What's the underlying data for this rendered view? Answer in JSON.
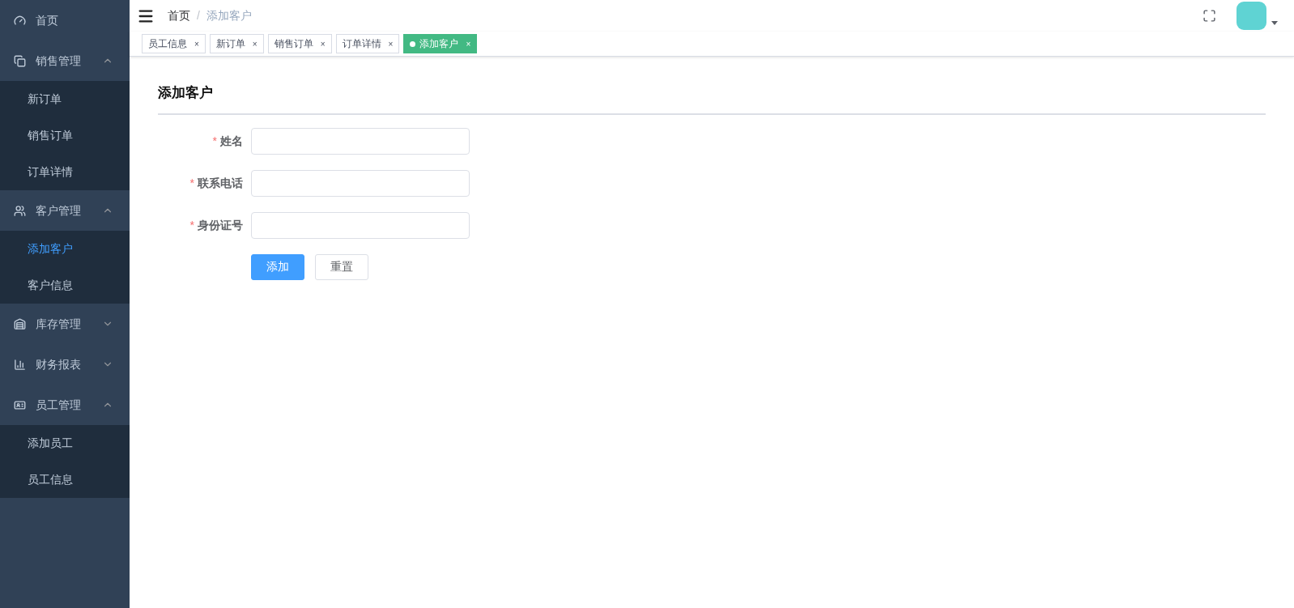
{
  "sidebar": {
    "menu": [
      {
        "label": "首页"
      },
      {
        "label": "销售管理",
        "expanded": true,
        "children": [
          {
            "label": "新订单",
            "selected": false
          },
          {
            "label": "销售订单",
            "selected": false
          },
          {
            "label": "订单详情",
            "selected": false
          }
        ]
      },
      {
        "label": "客户管理",
        "expanded": true,
        "children": [
          {
            "label": "添加客户",
            "selected": true
          },
          {
            "label": "客户信息",
            "selected": false
          }
        ]
      },
      {
        "label": "库存管理",
        "expanded": false
      },
      {
        "label": "财务报表",
        "expanded": false
      },
      {
        "label": "员工管理",
        "expanded": true,
        "children": [
          {
            "label": "添加员工",
            "selected": false
          },
          {
            "label": "员工信息",
            "selected": false
          }
        ]
      }
    ]
  },
  "breadcrumb": [
    "首页",
    "添加客户"
  ],
  "breadcrumb_separator": "/",
  "tabs": [
    {
      "label": "员工信息",
      "selected": false
    },
    {
      "label": "新订单",
      "selected": false
    },
    {
      "label": "销售订单",
      "selected": false
    },
    {
      "label": "订单详情",
      "selected": false
    },
    {
      "label": "添加客户",
      "selected": true
    }
  ],
  "tab_close": "×",
  "page": {
    "title": "添加客户",
    "fields": [
      {
        "label": "姓名",
        "required": true
      },
      {
        "label": "联系电话",
        "required": true
      },
      {
        "label": "身份证号",
        "required": true
      }
    ],
    "required_mark": "*",
    "buttons": [
      {
        "label": "添加",
        "kind": "primary"
      },
      {
        "label": "重置",
        "kind": "default"
      }
    ]
  }
}
